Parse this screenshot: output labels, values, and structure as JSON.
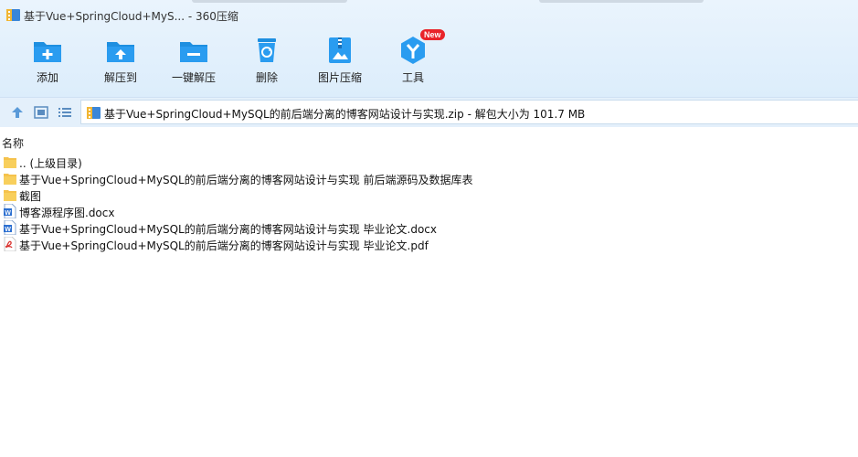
{
  "window": {
    "title": "基于Vue+SpringCloud+MyS... - 360压缩"
  },
  "toolbar": {
    "items": [
      {
        "label": "添加",
        "icon": "add-folder-icon"
      },
      {
        "label": "解压到",
        "icon": "extract-to-icon"
      },
      {
        "label": "一键解压",
        "icon": "one-click-extract-icon"
      },
      {
        "label": "删除",
        "icon": "delete-icon"
      },
      {
        "label": "图片压缩",
        "icon": "image-compress-icon"
      },
      {
        "label": "工具",
        "icon": "tools-icon",
        "badge": "New"
      }
    ]
  },
  "navigation": {
    "path": "基于Vue+SpringCloud+MySQL的前后端分离的博客网站设计与实现.zip - 解包大小为 101.7 MB"
  },
  "list": {
    "column_name": "名称",
    "rows": [
      {
        "name": ".. (上级目录)",
        "type": "folder"
      },
      {
        "name": "基于Vue+SpringCloud+MySQL的前后端分离的博客网站设计与实现 前后端源码及数据库表",
        "type": "folder"
      },
      {
        "name": "截图",
        "type": "folder"
      },
      {
        "name": "博客源程序图.docx",
        "type": "word"
      },
      {
        "name": "基于Vue+SpringCloud+MySQL的前后端分离的博客网站设计与实现 毕业论文.docx",
        "type": "word"
      },
      {
        "name": "基于Vue+SpringCloud+MySQL的前后端分离的博客网站设计与实现 毕业论文.pdf",
        "type": "pdf"
      }
    ]
  },
  "colors": {
    "accent": "#1e8fe0",
    "toolbar_bg": "#dcedfb",
    "folder": "#f5c24c",
    "pdf": "#d9302c",
    "word": "#2b6fd1"
  }
}
